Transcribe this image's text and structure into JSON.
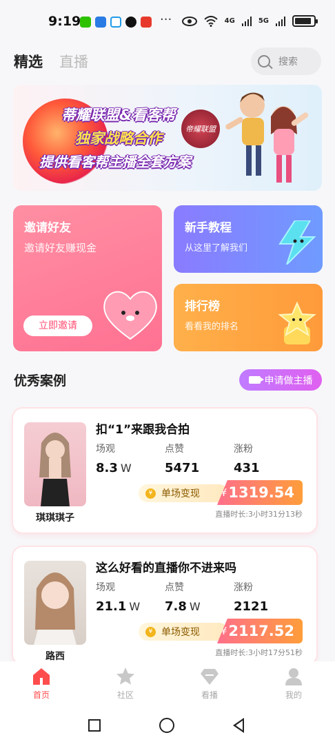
{
  "status_bar": {
    "time": "9:19",
    "more": "···",
    "signal1": "4G",
    "signal2": "5G",
    "battery_level": 0.9
  },
  "top_nav": {
    "tab_featured": "精选",
    "tab_live": "直播",
    "search_label": "搜索"
  },
  "banner": {
    "line1": "蒂耀联盟&看客帮",
    "line2": "独家战略合作",
    "line3": "提供看客帮主播全套方案",
    "seal_text": "帝耀联盟"
  },
  "cards": {
    "invite": {
      "title": "邀请好友",
      "subtitle": "邀请好友赚现金",
      "button": "立即邀请"
    },
    "tutorial": {
      "title": "新手教程",
      "subtitle": "从这里了解我们"
    },
    "rank": {
      "title": "排行榜",
      "subtitle": "看看我的排名"
    }
  },
  "section": {
    "title": "优秀案例",
    "apply_button": "申请做主播"
  },
  "cases": [
    {
      "name": "琪琪琪子",
      "title": "扣“1”来跟我合拍",
      "views_label": "场观",
      "views_value": "8.3",
      "views_unit": "W",
      "likes_label": "点赞",
      "likes_value": "5471",
      "likes_unit": "",
      "fans_label": "涨粉",
      "fans_value": "431",
      "earn_label": "单场变现",
      "currency": "¥",
      "amount": "1319.54",
      "duration": "直播时长:3小时31分13秒"
    },
    {
      "name": "路西",
      "title": "这么好看的直播你不进来吗",
      "views_label": "场观",
      "views_value": "21.1",
      "views_unit": "W",
      "likes_label": "点赞",
      "likes_value": "7.8",
      "likes_unit": "W",
      "fans_label": "涨粉",
      "fans_value": "2121",
      "earn_label": "单场变现",
      "currency": "¥",
      "amount": "2117.52",
      "duration": "直播时长:3小时17分51秒"
    }
  ],
  "tab_bar": {
    "home": "首页",
    "community": "社区",
    "watch": "看播",
    "mine": "我的",
    "active_color": "#ff4d4d",
    "inactive_color": "#c8c8c8"
  }
}
